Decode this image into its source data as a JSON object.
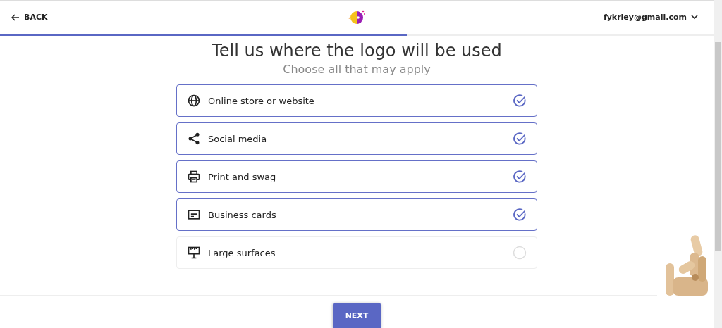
{
  "header": {
    "back": "BACK",
    "account": "fykriey@gmail.com"
  },
  "progress": {
    "level": 0.57
  },
  "heading": "Tell us where the logo will be used",
  "subtitle": "Choose all that may apply",
  "options": [
    {
      "label": "Online store or website",
      "kind": "globe",
      "checked": true
    },
    {
      "label": "Social media",
      "kind": "share",
      "checked": true
    },
    {
      "label": "Print and swag",
      "kind": "printer",
      "checked": true
    },
    {
      "label": "Business cards",
      "kind": "card",
      "checked": true
    },
    {
      "label": "Large surfaces",
      "kind": "billboard",
      "checked": false
    }
  ],
  "footer": {
    "next": "NEXT"
  }
}
